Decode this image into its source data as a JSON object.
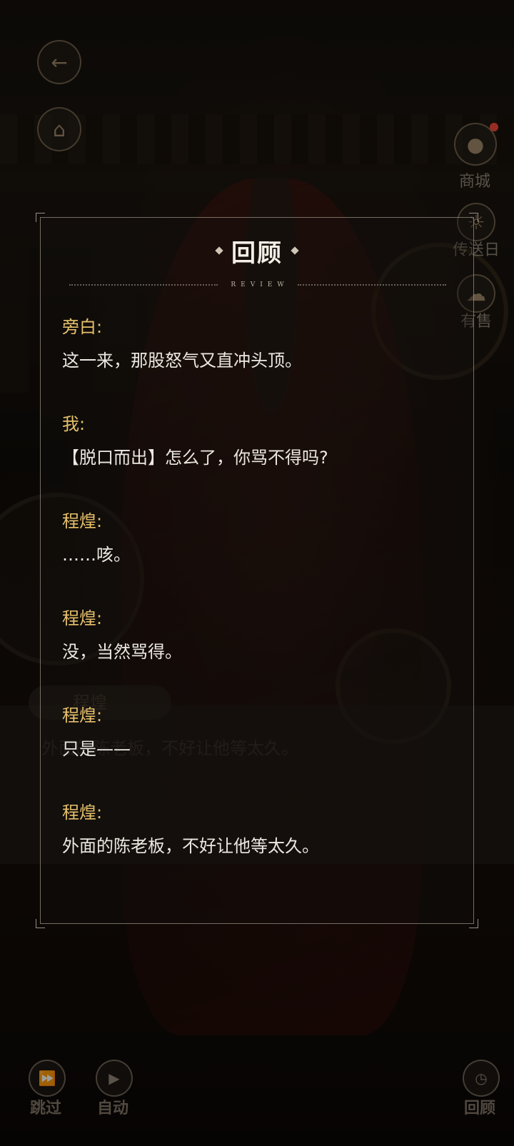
{
  "panel": {
    "title": "回顾",
    "subtitle": "REVIEW"
  },
  "entries": [
    {
      "speaker": "旁白:",
      "text": "这一来，那股怒气又直冲头顶。"
    },
    {
      "speaker": "我:",
      "text": "【脱口而出】怎么了，你骂不得吗?"
    },
    {
      "speaker": "程煌:",
      "text": "……咳。"
    },
    {
      "speaker": "程煌:",
      "text": "没，当然骂得。"
    },
    {
      "speaker": "程煌:",
      "text": "只是——"
    },
    {
      "speaker": "程煌:",
      "text": "外面的陈老板，不好让他等太久。"
    }
  ],
  "side_menu": {
    "shop_label": "商城",
    "diary_label": "传送日",
    "third_label": "有售"
  },
  "background_dialog": {
    "name": "程煌",
    "line": "外面的陈老板，不好让他等太久。"
  },
  "bottom_bar": {
    "skip_label": "跳过",
    "auto_label": "自动",
    "review_label": "回顾"
  },
  "colors": {
    "speaker": "#e6c06b",
    "text": "#ece8e1",
    "panel_border": "#c8beaf"
  }
}
